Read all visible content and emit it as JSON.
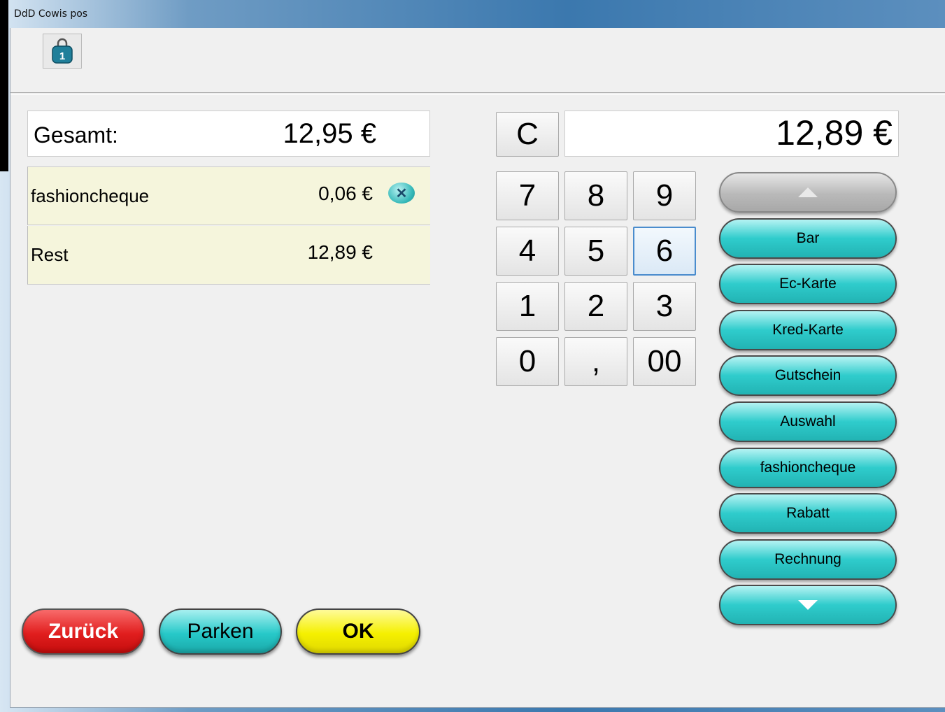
{
  "window": {
    "title": "DdD Cowis pos"
  },
  "toolbar": {
    "bag_icon_badge": "1"
  },
  "summary": {
    "total_label": "Gesamt:",
    "total_value": "12,95 €",
    "payments": [
      {
        "name": "fashioncheque",
        "amount": "0,06 €",
        "removable": true
      },
      {
        "name": "Rest",
        "amount": "12,89 €",
        "removable": false
      }
    ]
  },
  "actions": {
    "back": "Zurück",
    "park": "Parken",
    "ok": "OK"
  },
  "keypad": {
    "clear": "C",
    "display": "12,89 €",
    "keys": [
      "7",
      "8",
      "9",
      "4",
      "5",
      "6",
      "1",
      "2",
      "3",
      "0",
      ",",
      "00"
    ],
    "focused_key": "6"
  },
  "payment_methods": {
    "items": [
      "Bar",
      "Ec-Karte",
      "Kred-Karte",
      "Gutschein",
      "Auswahl",
      "fashioncheque",
      "Rabatt",
      "Rechnung"
    ]
  },
  "colors": {
    "accent_cyan": "#2fcccc",
    "back_red": "#e11e1e",
    "ok_yellow": "#f5f000",
    "row_background": "#f5f5dc"
  },
  "icons": {
    "bag": "shopping-bag-icon",
    "remove": "close-circle-icon",
    "scroll_up": "arrow-up-icon",
    "scroll_down": "arrow-down-icon"
  }
}
